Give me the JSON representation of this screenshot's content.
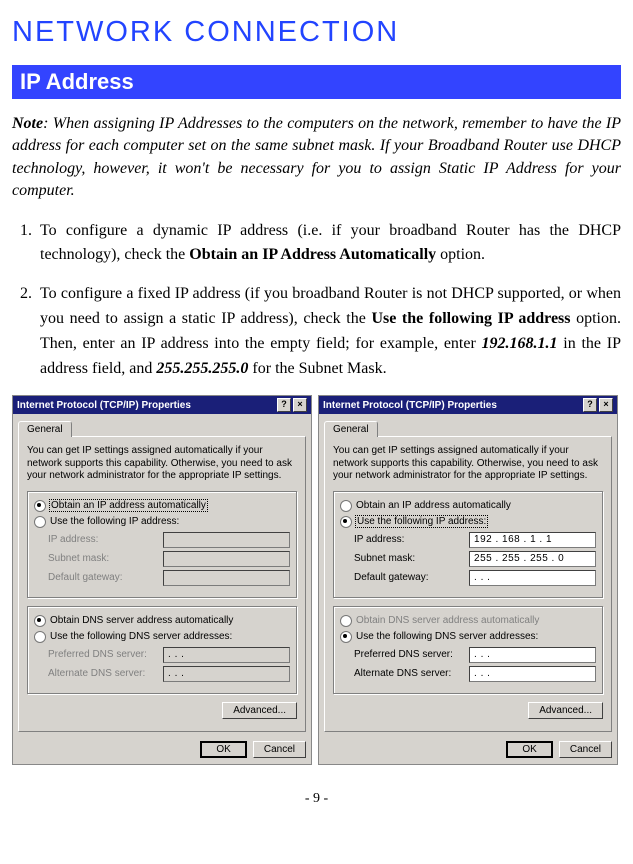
{
  "title": "NETWORK CONNECTION",
  "section": "IP Address",
  "note_label": "Note",
  "note_text": ": When assigning IP Addresses to the computers on the network, remember to have the IP address for each computer set on the same subnet mask. If your Broadband Router use DHCP technology, however, it won't be necessary for you to assign Static IP Address for your computer.",
  "step1_a": "To configure a dynamic IP address (i.e. if your broadband Router has the DHCP technology), check the ",
  "step1_b_bold": "Obtain an IP Address Automatically",
  "step1_c": " option.",
  "step2_a": "To configure a fixed IP address (if you broadband Router is not DHCP supported, or when you need to assign a static IP address), check the ",
  "step2_b_bold": "Use the following IP address",
  "step2_c": " option. Then, enter an IP address into the empty field; for example, enter ",
  "step2_ip": "192.168.1.1",
  "step2_d": " in the IP address field, and ",
  "step2_mask": "255.255.255.0",
  "step2_e": " for the Subnet Mask.",
  "dlg": {
    "title": "Internet Protocol (TCP/IP) Properties",
    "tab": "General",
    "intro": "You can get IP settings assigned automatically if your network supports this capability. Otherwise, you need to ask your network administrator for the appropriate IP settings.",
    "radio_auto": "Obtain an IP address automatically",
    "radio_manual": "Use the following IP address:",
    "lab_ip": "IP address:",
    "lab_mask": "Subnet mask:",
    "lab_gw": "Default gateway:",
    "radio_dns_auto": "Obtain DNS server address automatically",
    "radio_dns_manual": "Use the following DNS server addresses:",
    "lab_pdns": "Preferred DNS server:",
    "lab_adns": "Alternate DNS server:",
    "btn_adv": "Advanced...",
    "btn_ok": "OK",
    "btn_cancel": "Cancel",
    "val_ip": "192 . 168 .   1 .   1",
    "val_mask": "255 . 255 . 255 .   0",
    "dots": ".    .    ."
  },
  "page_number": "- 9 -"
}
